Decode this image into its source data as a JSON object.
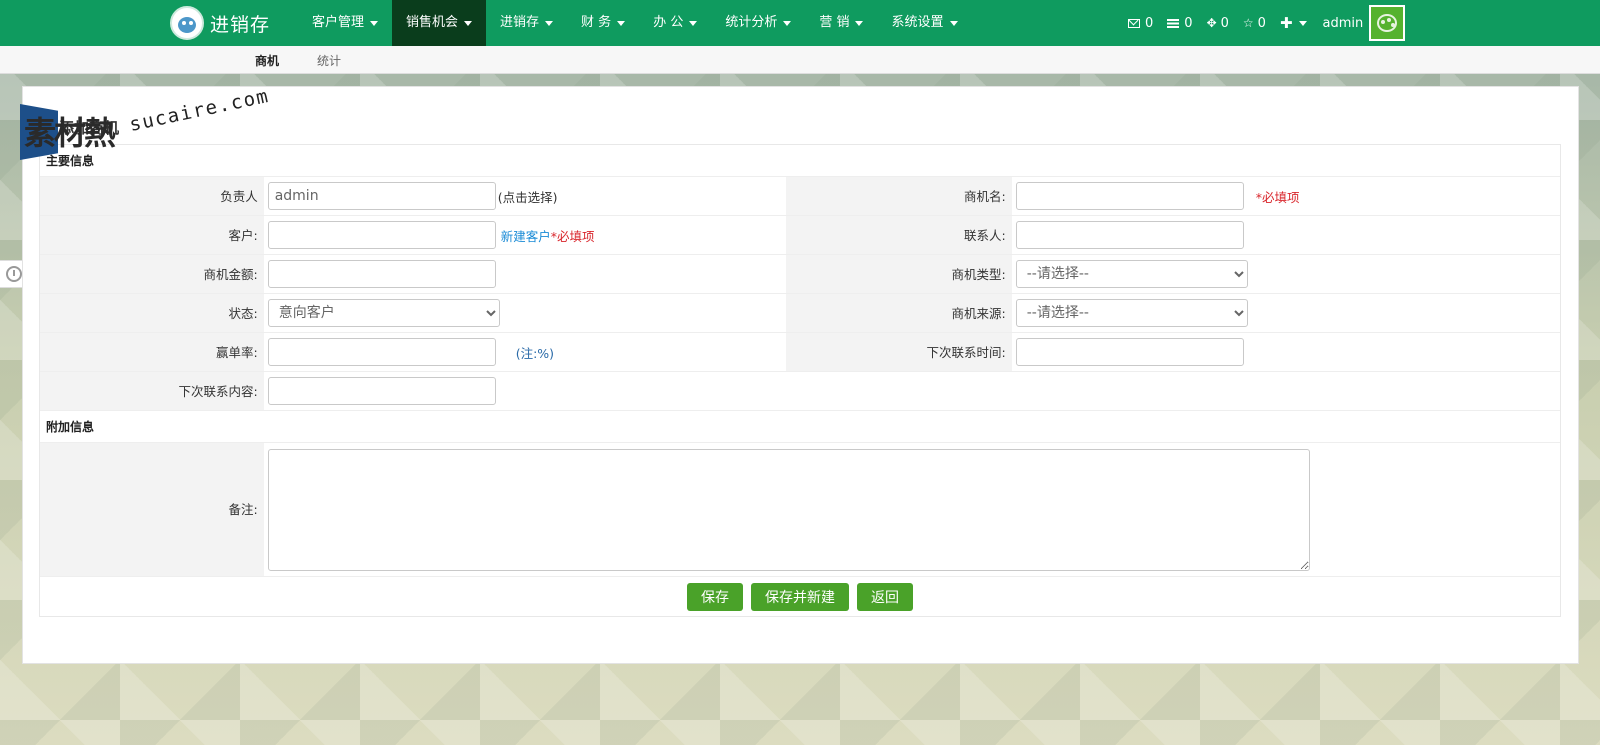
{
  "brand": {
    "name": "进销存"
  },
  "nav": {
    "items": [
      {
        "label": "客户管理"
      },
      {
        "label": "销售机会"
      },
      {
        "label": "进销存"
      },
      {
        "label": "财 务"
      },
      {
        "label": "办 公"
      },
      {
        "label": "统计分析"
      },
      {
        "label": "营 销"
      },
      {
        "label": "系统设置"
      }
    ],
    "active_index": 1
  },
  "header_right": {
    "messages": "0",
    "notices": "0",
    "tasks": "0",
    "favorites": "0",
    "user": "admin"
  },
  "subnav": {
    "tabs": [
      {
        "label": "商机"
      },
      {
        "label": "统计"
      }
    ]
  },
  "page": {
    "title": "添加商机"
  },
  "watermark": {
    "text": "素材熱",
    "site": "sucaire.com"
  },
  "form": {
    "section_main": "主要信息",
    "section_extra": "附加信息",
    "owner": {
      "label": "负责人",
      "value": "admin",
      "hint": "(点击选择)"
    },
    "opportunity_name": {
      "label": "商机名:",
      "value": "",
      "required": "*必填项"
    },
    "customer": {
      "label": "客户:",
      "value": "",
      "new_link": "新建客户",
      "required": "*必填项"
    },
    "contact": {
      "label": "联系人:",
      "value": ""
    },
    "amount": {
      "label": "商机金额:",
      "value": ""
    },
    "type": {
      "label": "商机类型:",
      "selected": "--请选择--"
    },
    "status": {
      "label": "状态:",
      "selected": "意向客户"
    },
    "source": {
      "label": "商机来源:",
      "selected": "--请选择--"
    },
    "win_rate": {
      "label": "赢单率:",
      "value": "",
      "note": "(注:%)"
    },
    "next_contact_time": {
      "label": "下次联系时间:",
      "value": ""
    },
    "next_contact_content": {
      "label": "下次联系内容:",
      "value": ""
    },
    "remarks": {
      "label": "备注:",
      "value": ""
    }
  },
  "actions": {
    "save": "保存",
    "save_new": "保存并新建",
    "back": "返回"
  }
}
